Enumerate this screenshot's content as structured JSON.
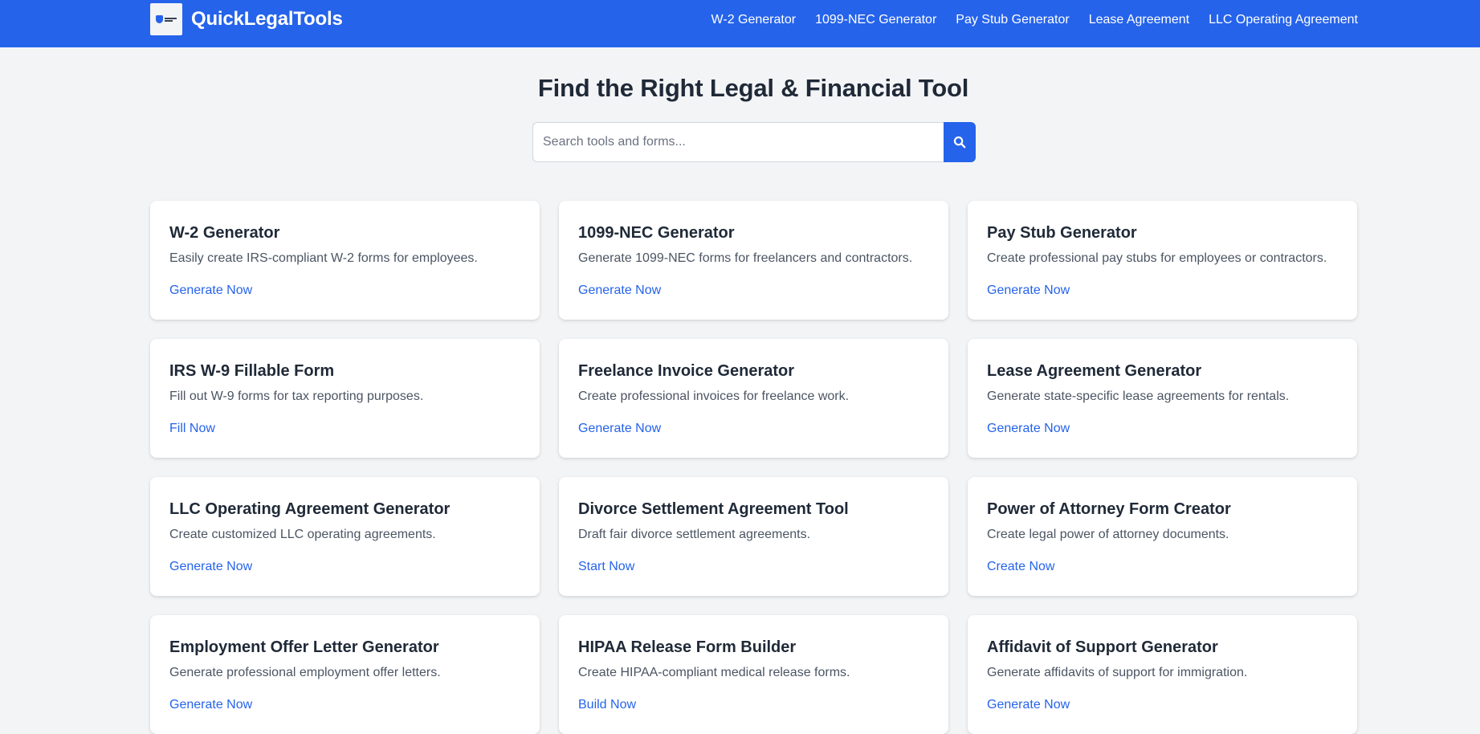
{
  "header": {
    "brand": {
      "logo_text": "QuickLegal Tools",
      "name": "QuickLegalTools"
    },
    "nav": [
      {
        "label": "W-2 Generator"
      },
      {
        "label": "1099-NEC Generator"
      },
      {
        "label": "Pay Stub Generator"
      },
      {
        "label": "Lease Agreement"
      },
      {
        "label": "LLC Operating Agreement"
      }
    ]
  },
  "hero": {
    "title": "Find the Right Legal & Financial Tool"
  },
  "search": {
    "placeholder": "Search tools and forms...",
    "value": "",
    "icon": "search-icon"
  },
  "tools": [
    {
      "title": "W-2 Generator",
      "description": "Easily create IRS-compliant W-2 forms for employees.",
      "cta": "Generate Now"
    },
    {
      "title": "1099-NEC Generator",
      "description": "Generate 1099-NEC forms for freelancers and contractors.",
      "cta": "Generate Now"
    },
    {
      "title": "Pay Stub Generator",
      "description": "Create professional pay stubs for employees or contractors.",
      "cta": "Generate Now"
    },
    {
      "title": "IRS W-9 Fillable Form",
      "description": "Fill out W-9 forms for tax reporting purposes.",
      "cta": "Fill Now"
    },
    {
      "title": "Freelance Invoice Generator",
      "description": "Create professional invoices for freelance work.",
      "cta": "Generate Now"
    },
    {
      "title": "Lease Agreement Generator",
      "description": "Generate state-specific lease agreements for rentals.",
      "cta": "Generate Now"
    },
    {
      "title": "LLC Operating Agreement Generator",
      "description": "Create customized LLC operating agreements.",
      "cta": "Generate Now"
    },
    {
      "title": "Divorce Settlement Agreement Tool",
      "description": "Draft fair divorce settlement agreements.",
      "cta": "Start Now"
    },
    {
      "title": "Power of Attorney Form Creator",
      "description": "Create legal power of attorney documents.",
      "cta": "Create Now"
    },
    {
      "title": "Employment Offer Letter Generator",
      "description": "Generate professional employment offer letters.",
      "cta": "Generate Now"
    },
    {
      "title": "HIPAA Release Form Builder",
      "description": "Create HIPAA-compliant medical release forms.",
      "cta": "Build Now"
    },
    {
      "title": "Affidavit of Support Generator",
      "description": "Generate affidavits of support for immigration.",
      "cta": "Generate Now"
    }
  ],
  "colors": {
    "primary": "#2563eb",
    "page_background": "#f3f4f6",
    "card_background": "#ffffff",
    "heading_text": "#1f2937",
    "body_text": "#4b5563"
  }
}
